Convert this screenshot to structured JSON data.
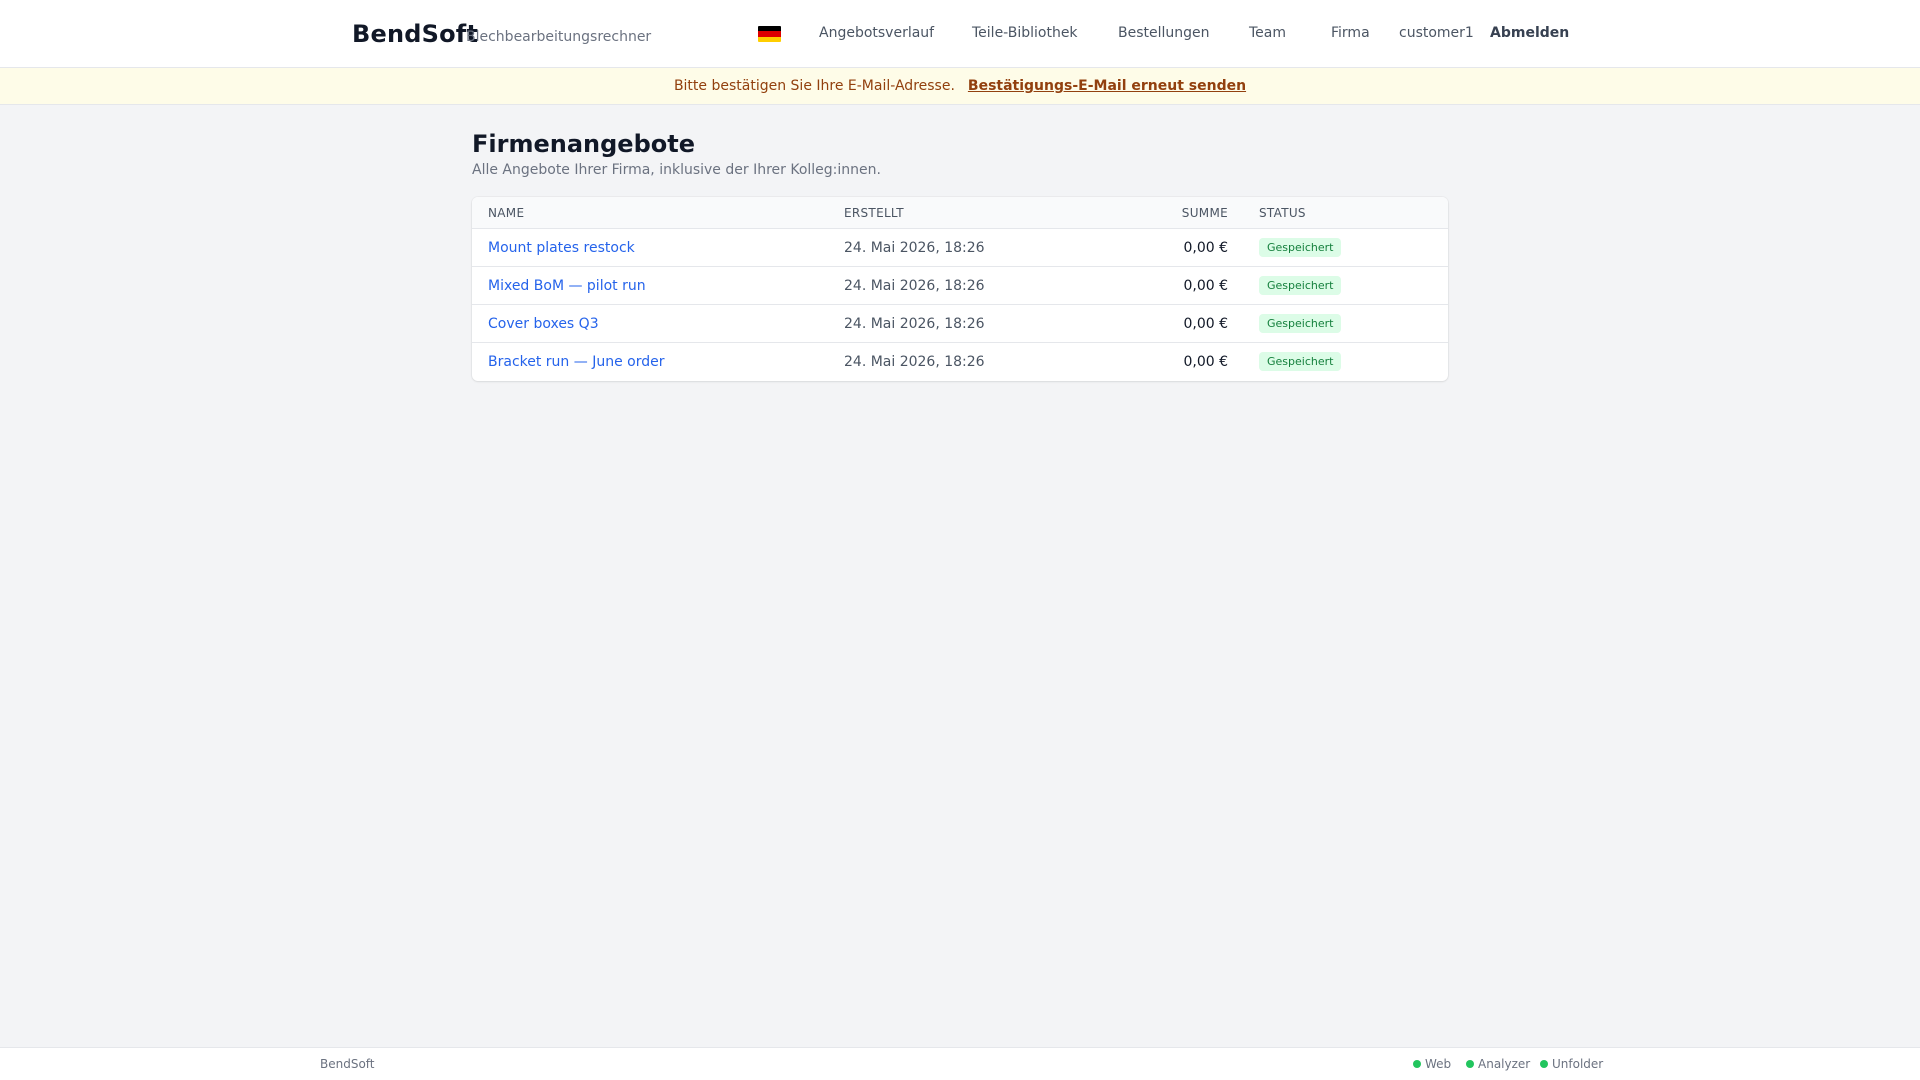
{
  "header": {
    "brand": "BendSoft",
    "subtitle": "Blechbearbeitungsrechner",
    "flag_icon": "germany-flag-icon",
    "flag_colors": [
      "#000000",
      "#dd0000",
      "#ffce00"
    ],
    "nav": {
      "quote_history": "Angebotsverlauf",
      "parts_library": "Teile-Bibliothek",
      "orders": "Bestellungen",
      "team": "Team",
      "company": "Firma"
    },
    "username": "customer1",
    "logout": "Abmelden"
  },
  "banner": {
    "message": "Bitte bestätigen Sie Ihre E-Mail-Adresse.",
    "link": "Bestätigungs-E-Mail erneut senden"
  },
  "main": {
    "title": "Firmenangebote",
    "subtitle": "Alle Angebote Ihrer Firma, inklusive der Ihrer Kolleg:innen.",
    "table": {
      "columns": [
        "Name",
        "Erstellt",
        "Summe",
        "Status"
      ],
      "rows": [
        {
          "name": "Mount plates restock",
          "created": "24. Mai 2026, 18:26",
          "sum": "0,00 €",
          "status": "Gespeichert"
        },
        {
          "name": "Mixed BoM — pilot run",
          "created": "24. Mai 2026, 18:26",
          "sum": "0,00 €",
          "status": "Gespeichert"
        },
        {
          "name": "Cover boxes Q3",
          "created": "24. Mai 2026, 18:26",
          "sum": "0,00 €",
          "status": "Gespeichert"
        },
        {
          "name": "Bracket run — June order",
          "created": "24. Mai 2026, 18:26",
          "sum": "0,00 €",
          "status": "Gespeichert"
        }
      ]
    }
  },
  "footer": {
    "brand": "BendSoft",
    "services": [
      {
        "label": "Web",
        "color": "#22c55e"
      },
      {
        "label": "Analyzer",
        "color": "#22c55e"
      },
      {
        "label": "Unfolder",
        "color": "#22c55e"
      }
    ]
  }
}
